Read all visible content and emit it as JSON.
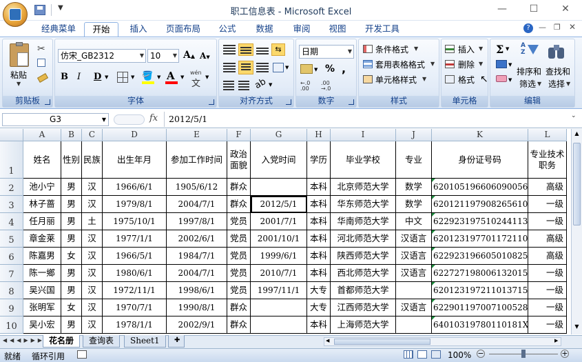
{
  "window": {
    "title": "职工信息表 - Microsoft Excel",
    "minimize": "—",
    "maximize": "☐",
    "close": "✕"
  },
  "ribbon_tabs": [
    "经典菜单",
    "开始",
    "插入",
    "页面布局",
    "公式",
    "数据",
    "审阅",
    "视图",
    "开发工具"
  ],
  "active_tab": "开始",
  "ribbon": {
    "clipboard": {
      "paste": "粘贴",
      "label": "剪贴板"
    },
    "font": {
      "name": "仿宋_GB2312",
      "size": "10",
      "label": "字体",
      "bold": "B",
      "italic": "I",
      "underline": "D",
      "wen": "wén"
    },
    "alignment": {
      "label": "对齐方式"
    },
    "number": {
      "format": "日期",
      "percent": "%",
      "comma": ",",
      "label": "数字"
    },
    "styles": {
      "conditional": "条件格式",
      "table": "套用表格格式",
      "cell": "单元格样式",
      "label": "样式"
    },
    "cells": {
      "insert": "插入",
      "delete": "删除",
      "format": "格式",
      "label": "单元格"
    },
    "editing": {
      "sort": "排序和",
      "sort2": "筛选",
      "find": "查找和",
      "find2": "选择",
      "label": "编辑"
    }
  },
  "formula_bar": {
    "name_box": "G3",
    "fx": "fx",
    "value": "2012/5/1"
  },
  "columns": [
    "A",
    "B",
    "C",
    "D",
    "E",
    "F",
    "G",
    "H",
    "I",
    "J",
    "K",
    "L"
  ],
  "header_row": {
    "row": "1",
    "cells": [
      "姓名",
      "性别",
      "民族",
      "出生年月",
      "参加工作时间",
      "政治面貌",
      "入党时间",
      "学历",
      "毕业学校",
      "专业",
      "身份证号码",
      "专业技术职务"
    ]
  },
  "rows": [
    {
      "num": "2",
      "cells": [
        "池小宁",
        "男",
        "汉",
        "1966/6/1",
        "1905/6/12",
        "群众",
        "",
        "本科",
        "北京师范大学",
        "数学",
        "620105196606090056",
        "高级"
      ]
    },
    {
      "num": "3",
      "cells": [
        "林子蔷",
        "男",
        "汉",
        "1979/8/1",
        "2004/7/1",
        "群众",
        "2012/5/1",
        "本科",
        "华东师范大学",
        "数学",
        "620121197908265610",
        "一级"
      ]
    },
    {
      "num": "4",
      "cells": [
        "任月丽",
        "男",
        "土",
        "1975/10/1",
        "1997/8/1",
        "党员",
        "2001/7/1",
        "本科",
        "华南师范大学",
        "中文",
        "622923197510244113",
        "一级"
      ]
    },
    {
      "num": "5",
      "cells": [
        "章金莱",
        "男",
        "汉",
        "1977/1/1",
        "2002/6/1",
        "党员",
        "2001/10/1",
        "本科",
        "河北师范大学",
        "汉语言",
        "620123197701172110",
        "高级"
      ]
    },
    {
      "num": "6",
      "cells": [
        "陈嘉男",
        "女",
        "汉",
        "1966/5/1",
        "1984/7/1",
        "党员",
        "1999/6/1",
        "本科",
        "陕西师范大学",
        "汉语言",
        "622923196605010825",
        "高级"
      ]
    },
    {
      "num": "7",
      "cells": [
        "陈一鄉",
        "男",
        "汉",
        "1980/6/1",
        "2004/7/1",
        "党员",
        "2010/7/1",
        "本科",
        "西北师范大学",
        "汉语言",
        "622727198006132015",
        "一级"
      ]
    },
    {
      "num": "8",
      "cells": [
        "吴兴国",
        "男",
        "汉",
        "1972/11/1",
        "1998/6/1",
        "党员",
        "1997/11/1",
        "大专",
        "首都师范大学",
        "",
        "620123197211013715",
        "一级"
      ]
    },
    {
      "num": "9",
      "cells": [
        "张明军",
        "女",
        "汉",
        "1970/7/1",
        "1990/8/1",
        "群众",
        "",
        "大专",
        "江西师范大学",
        "汉语言",
        "622901197007100528",
        "一级"
      ]
    },
    {
      "num": "10",
      "cells": [
        "吴小宏",
        "男",
        "汉",
        "1978/1/1",
        "2002/9/1",
        "群众",
        "",
        "本科",
        "上海师范大学",
        "",
        "64010319780110181X",
        "一级"
      ]
    }
  ],
  "sheet_tabs": [
    "花名册",
    "查询表",
    "Sheet1"
  ],
  "active_sheet": "花名册",
  "status": {
    "ready": "就绪",
    "circular": "循环引用",
    "zoom": "100%"
  }
}
